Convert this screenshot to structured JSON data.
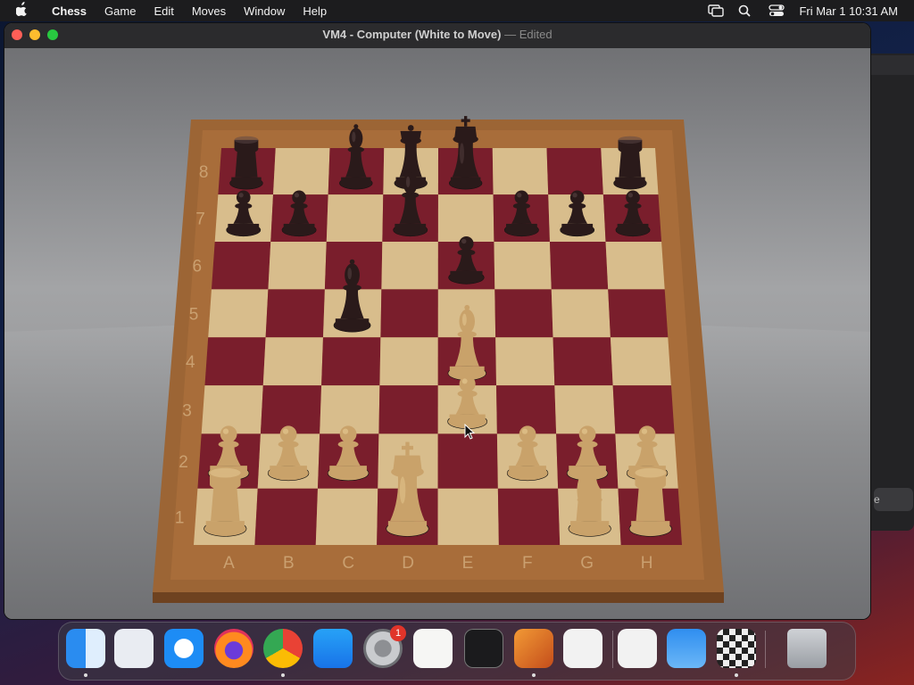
{
  "menubar": {
    "app": "Chess",
    "items": [
      "Game",
      "Edit",
      "Moves",
      "Window",
      "Help"
    ],
    "clock": "Fri Mar 1  10:31 AM"
  },
  "window": {
    "title": "VM4 - Computer   (White to Move)",
    "separator": "—",
    "edited": "Edited"
  },
  "board": {
    "files": [
      "A",
      "B",
      "C",
      "D",
      "E",
      "F",
      "G",
      "H"
    ],
    "ranks": [
      "1",
      "2",
      "3",
      "4",
      "5",
      "6",
      "7",
      "8"
    ],
    "pieces": [
      {
        "sq": "a8",
        "color": "black",
        "type": "rook"
      },
      {
        "sq": "c8",
        "color": "black",
        "type": "bishop"
      },
      {
        "sq": "d8",
        "color": "black",
        "type": "queen"
      },
      {
        "sq": "e8",
        "color": "black",
        "type": "king"
      },
      {
        "sq": "h8",
        "color": "black",
        "type": "rook"
      },
      {
        "sq": "a7",
        "color": "black",
        "type": "pawn"
      },
      {
        "sq": "b7",
        "color": "black",
        "type": "pawn"
      },
      {
        "sq": "d7",
        "color": "black",
        "type": "bishop"
      },
      {
        "sq": "f7",
        "color": "black",
        "type": "pawn"
      },
      {
        "sq": "g7",
        "color": "black",
        "type": "pawn"
      },
      {
        "sq": "h7",
        "color": "black",
        "type": "pawn"
      },
      {
        "sq": "e6",
        "color": "black",
        "type": "pawn"
      },
      {
        "sq": "c5",
        "color": "black",
        "type": "bishop"
      },
      {
        "sq": "e4",
        "color": "white",
        "type": "bishop"
      },
      {
        "sq": "e3",
        "color": "white",
        "type": "pawn"
      },
      {
        "sq": "a2",
        "color": "white",
        "type": "pawn"
      },
      {
        "sq": "b2",
        "color": "white",
        "type": "pawn"
      },
      {
        "sq": "c2",
        "color": "white",
        "type": "pawn"
      },
      {
        "sq": "f2",
        "color": "white",
        "type": "pawn"
      },
      {
        "sq": "g2",
        "color": "white",
        "type": "pawn"
      },
      {
        "sq": "h2",
        "color": "white",
        "type": "pawn"
      },
      {
        "sq": "a1",
        "color": "white",
        "type": "rook"
      },
      {
        "sq": "d1",
        "color": "white",
        "type": "king"
      },
      {
        "sq": "g1",
        "color": "white",
        "type": "knight"
      },
      {
        "sq": "h1",
        "color": "white",
        "type": "rook"
      }
    ]
  },
  "background_window": {
    "button_label": "e"
  },
  "dock": {
    "apps": [
      {
        "name": "finder",
        "running": true
      },
      {
        "name": "launchpad",
        "running": false
      },
      {
        "name": "safari",
        "running": false
      },
      {
        "name": "firefox",
        "running": false
      },
      {
        "name": "chrome",
        "running": true
      },
      {
        "name": "app-store",
        "running": false
      },
      {
        "name": "system-settings",
        "running": false,
        "badge": "1"
      },
      {
        "name": "textedit",
        "running": false
      },
      {
        "name": "terminal",
        "running": false
      },
      {
        "name": "garageband",
        "running": true
      },
      {
        "name": "vscode",
        "running": false
      },
      {
        "name": "visual-studio",
        "running": false
      },
      {
        "name": "weather",
        "running": false
      },
      {
        "name": "chess",
        "running": true
      },
      {
        "name": "trash",
        "running": false
      }
    ]
  },
  "colors": {
    "dark_square": "#7a1e2c",
    "light_square": "#d8bd8c",
    "frame": "#9c6535",
    "black_piece": "#2a1a1a",
    "white_piece": "#c9a26a"
  }
}
